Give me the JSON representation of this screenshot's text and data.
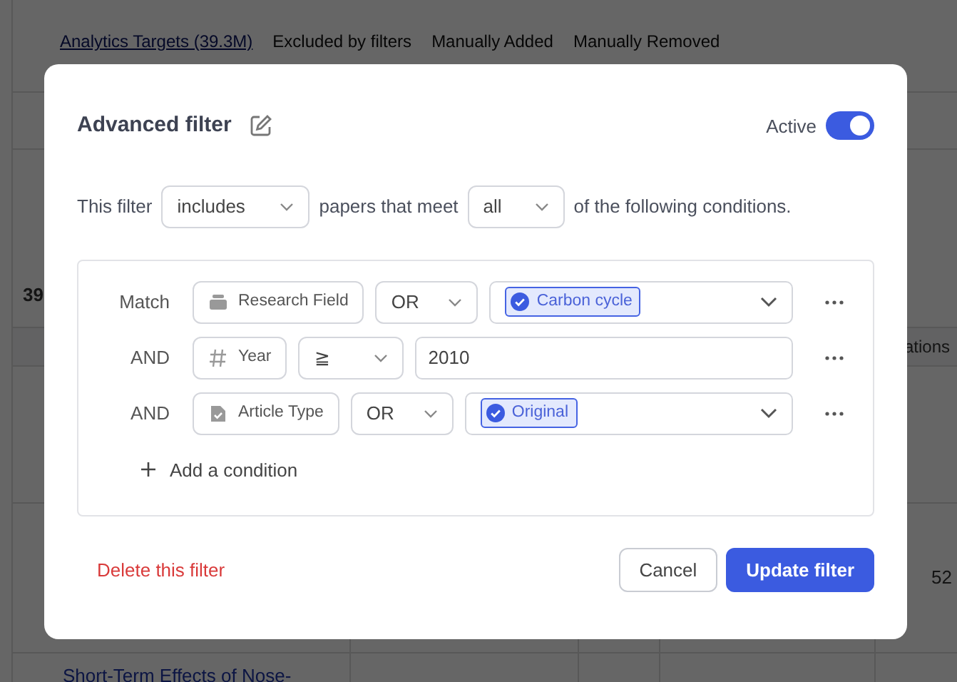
{
  "background": {
    "tabs": [
      {
        "label": "Analytics Targets  (39.3M)",
        "selected": true
      },
      {
        "label": "Excluded by filters",
        "selected": false
      },
      {
        "label": "Manually Added",
        "selected": false
      },
      {
        "label": "Manually Removed",
        "selected": false
      }
    ],
    "count_fragment": "39",
    "column_fragment": "ations",
    "cell_fragment": "52",
    "title_fragment": "Short-Term Effects of Nose-"
  },
  "dialog": {
    "title": "Advanced filter",
    "active_label": "Active",
    "active": true,
    "sentence": {
      "prefix": "This filter",
      "mode": "includes",
      "middle": "papers that meet",
      "quantifier": "all",
      "suffix": "of the following conditions."
    },
    "conditions": [
      {
        "connector": "Match",
        "field": "Research Field",
        "operator": "OR",
        "kind": "tags",
        "tags": [
          "Carbon cycle"
        ]
      },
      {
        "connector": "AND",
        "field": "Year",
        "operator": "≧",
        "kind": "input",
        "value": "2010"
      },
      {
        "connector": "AND",
        "field": "Article Type",
        "operator": "OR",
        "kind": "tags",
        "tags": [
          "Original"
        ]
      }
    ],
    "add_label": "Add a condition",
    "delete_label": "Delete this filter",
    "buttons": [
      {
        "label": "Cancel",
        "kind": "secondary"
      },
      {
        "label": "Update filter",
        "kind": "primary"
      }
    ]
  }
}
